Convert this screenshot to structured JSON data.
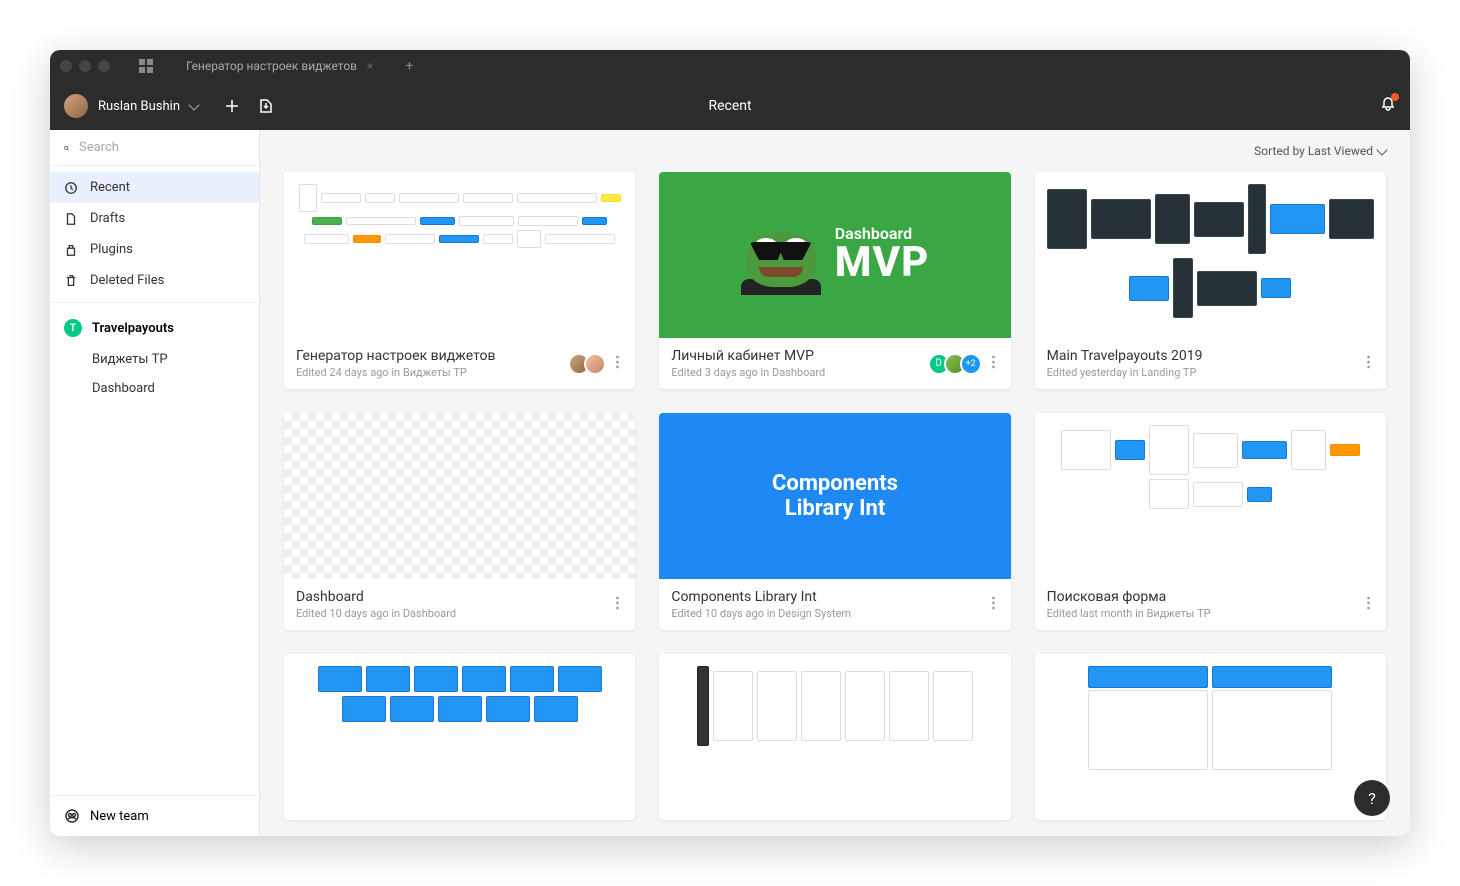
{
  "tab": {
    "title": "Генератор настроек виджетов"
  },
  "user": {
    "name": "Ruslan Bushin"
  },
  "page": {
    "title": "Recent"
  },
  "search": {
    "placeholder": "Search"
  },
  "nav": {
    "recent": "Recent",
    "drafts": "Drafts",
    "plugins": "Plugins",
    "deleted": "Deleted Files"
  },
  "team": {
    "badge": "T",
    "name": "Travelpayouts",
    "projects": [
      "Виджеты TP",
      "Dashboard"
    ]
  },
  "newTeam": "New team",
  "sort": {
    "label": "Sorted by Last Viewed"
  },
  "cards": [
    {
      "title": "Генератор настроек виджетов",
      "sub": "Edited 24 days ago in Виджеты TP",
      "collabs": {
        "type": "two"
      }
    },
    {
      "title": "Личный кабинет MVP",
      "sub": "Edited 3 days ago in Dashboard",
      "thumbText1": "Dashboard",
      "thumbText2": "MVP",
      "collabs": {
        "type": "three",
        "more": "+2",
        "d": "D"
      }
    },
    {
      "title": "Main Travelpayouts 2019",
      "sub": "Edited yesterday in Landing TP"
    },
    {
      "title": "Dashboard",
      "sub": "Edited 10 days ago in Dashboard"
    },
    {
      "title": "Components Library Int",
      "sub": "Edited 10 days ago in Design System",
      "thumbText1": "Components",
      "thumbText2": "Library Int"
    },
    {
      "title": "Поисковая форма",
      "sub": "Edited last month in Виджеты TP"
    }
  ],
  "help": "?"
}
